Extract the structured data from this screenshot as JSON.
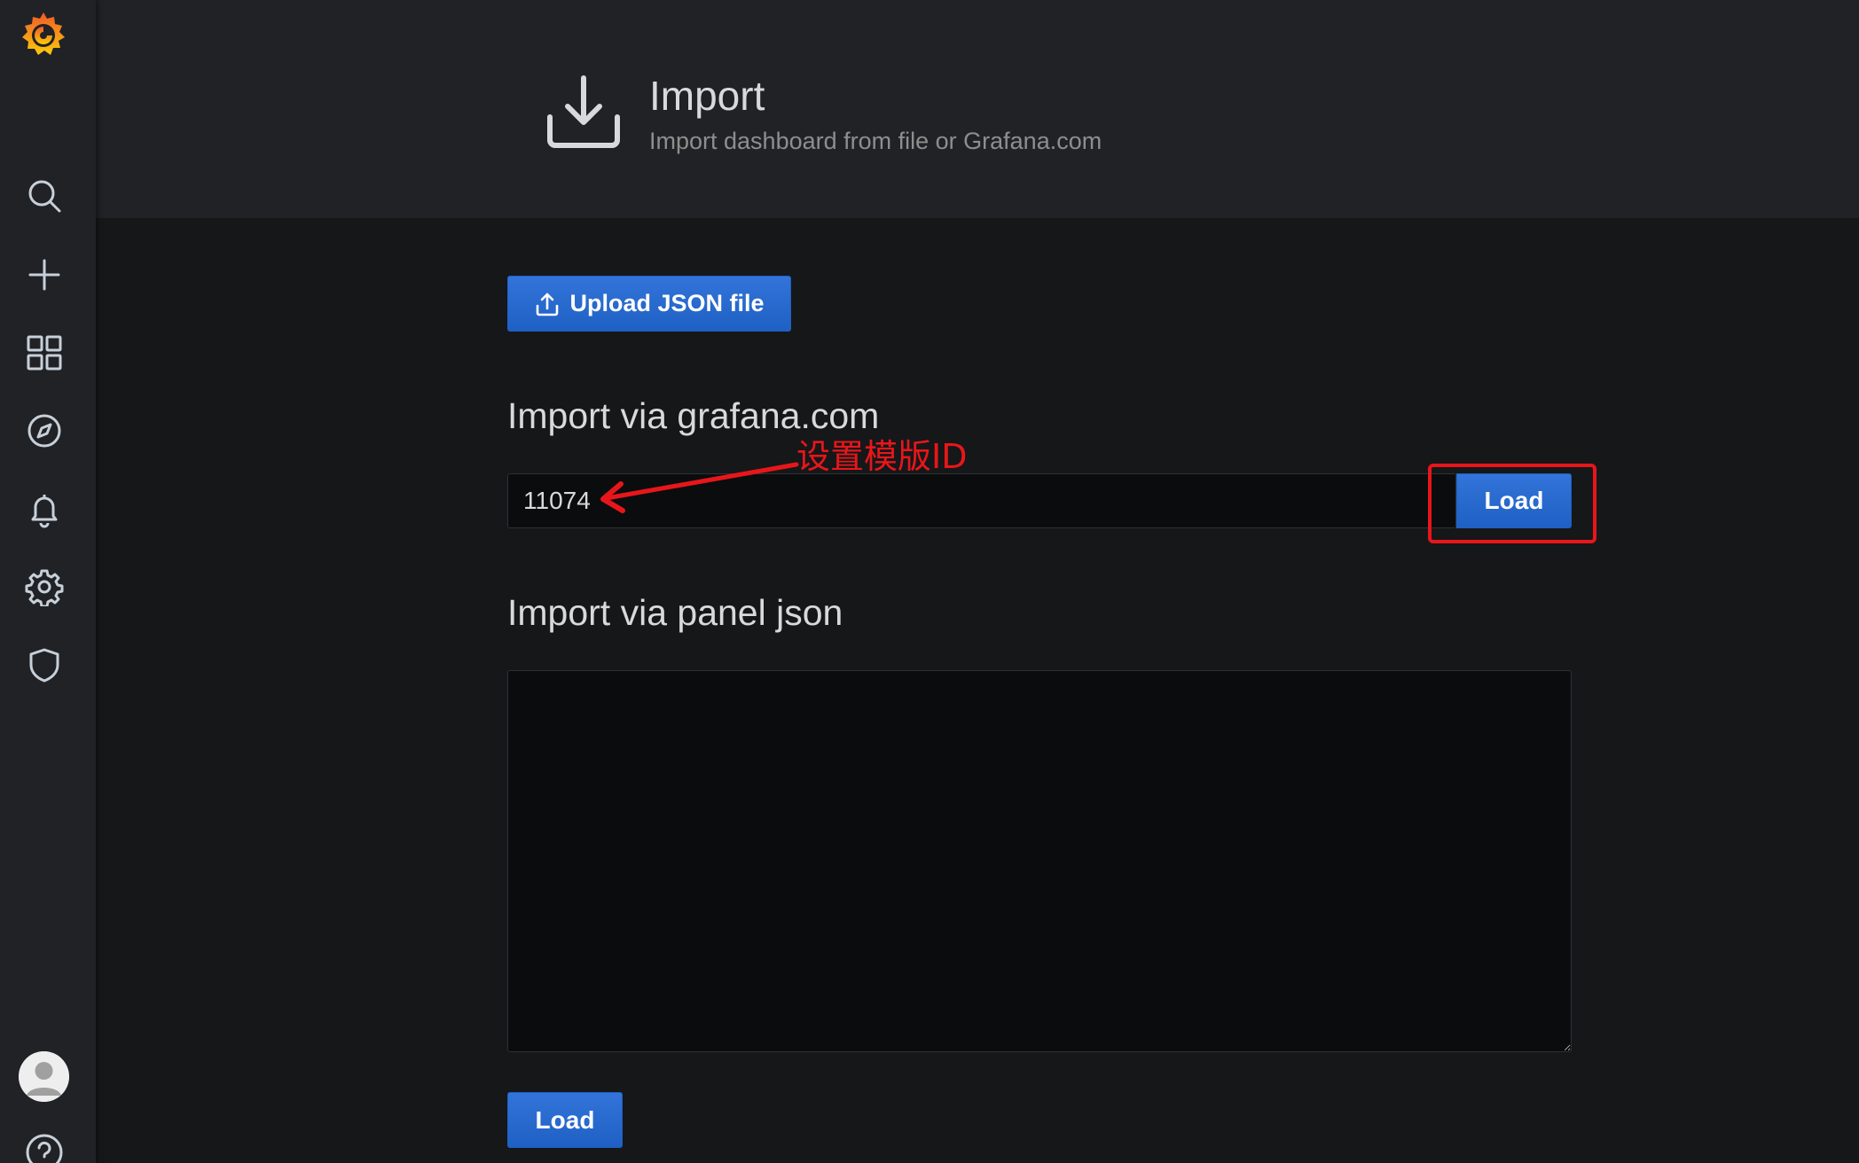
{
  "app": {
    "name": "Grafana"
  },
  "sidebar": {
    "items": [
      {
        "name": "search",
        "icon": "search-icon"
      },
      {
        "name": "create",
        "icon": "plus-icon"
      },
      {
        "name": "dashboards",
        "icon": "apps-grid-icon"
      },
      {
        "name": "explore",
        "icon": "compass-icon"
      },
      {
        "name": "alerting",
        "icon": "bell-icon"
      },
      {
        "name": "configuration",
        "icon": "gear-icon"
      },
      {
        "name": "server-admin",
        "icon": "shield-icon"
      }
    ],
    "bottom": [
      {
        "name": "profile",
        "icon": "avatar"
      },
      {
        "name": "help",
        "icon": "question-circle-icon"
      }
    ]
  },
  "header": {
    "title": "Import",
    "subtitle": "Import dashboard from file or Grafana.com",
    "icon": "import-download-icon"
  },
  "upload": {
    "label": "Upload JSON file",
    "icon": "upload-icon"
  },
  "grafana_com": {
    "title": "Import via grafana.com",
    "input_value": "11074",
    "load_label": "Load"
  },
  "panel_json": {
    "title": "Import via panel json",
    "value": "",
    "load_label": "Load"
  },
  "annotation": {
    "label": "设置模版ID",
    "color": "#e8161a"
  },
  "colors": {
    "primary": "#1f60c4",
    "background": "#161719",
    "panel": "#202226",
    "input_bg": "#0b0c0e",
    "logo_orange": "#f05a28",
    "logo_yellow": "#fbca0a"
  }
}
